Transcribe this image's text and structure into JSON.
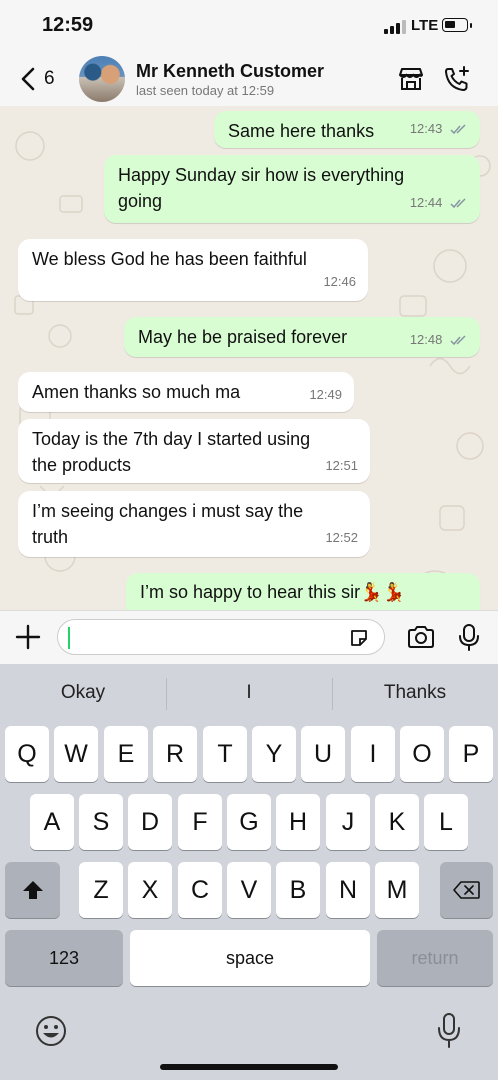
{
  "status_bar": {
    "time": "12:59",
    "network": "LTE"
  },
  "header": {
    "back_count": "6",
    "contact_name": "Mr Kenneth Customer",
    "last_seen": "last seen today at 12:59"
  },
  "messages": [
    {
      "direction": "outgoing",
      "lines": [
        "Same here thanks"
      ],
      "time": "12:43",
      "read": true
    },
    {
      "direction": "outgoing",
      "lines": [
        "Happy Sunday sir how is everything",
        "going"
      ],
      "time": "12:44",
      "read": true
    },
    {
      "direction": "incoming",
      "lines": [
        "We bless God he has been faithful"
      ],
      "time": "12:46"
    },
    {
      "direction": "outgoing",
      "lines": [
        "May he be praised forever"
      ],
      "time": "12:48",
      "read": true
    },
    {
      "direction": "incoming",
      "lines": [
        "Amen thanks so much ma"
      ],
      "time": "12:49"
    },
    {
      "direction": "incoming",
      "lines": [
        "Today is the 7th day I started using",
        "the products"
      ],
      "time": "12:51"
    },
    {
      "direction": "incoming",
      "lines": [
        "I’m seeing changes i must say the",
        "truth"
      ],
      "time": "12:52"
    },
    {
      "direction": "outgoing",
      "lines": [
        "I’m so happy to hear this sir💃💃"
      ],
      "time": ""
    }
  ],
  "input": {
    "value": ""
  },
  "keyboard": {
    "suggestions": [
      "Okay",
      "I",
      "Thanks"
    ],
    "row1": [
      "Q",
      "W",
      "E",
      "R",
      "T",
      "Y",
      "U",
      "I",
      "O",
      "P"
    ],
    "row2": [
      "A",
      "S",
      "D",
      "F",
      "G",
      "H",
      "J",
      "K",
      "L"
    ],
    "row3": [
      "Z",
      "X",
      "C",
      "V",
      "B",
      "N",
      "M"
    ],
    "numbers_key": "123",
    "space_key": "space",
    "return_key": "return"
  },
  "colors": {
    "outgoing_bubble": "#d9fdd3",
    "incoming_bubble": "#ffffff",
    "read_ticks": "#8696a0"
  }
}
